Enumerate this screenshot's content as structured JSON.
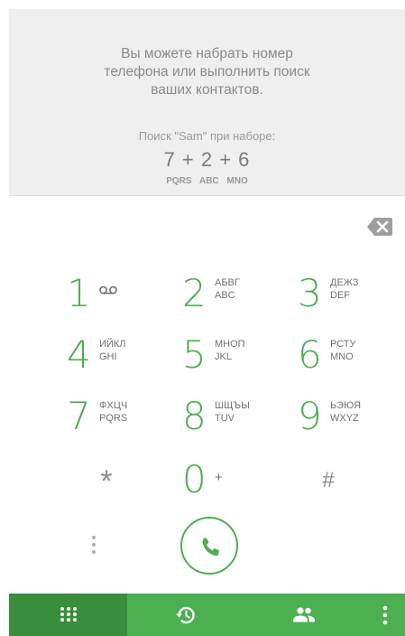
{
  "hint": {
    "line1": "Вы можете набрать номер",
    "line2": "телефона или выполнить поиск",
    "line3": "ваших контактов.",
    "search_caption": "Поиск \"Sam\" при наборе:",
    "search_digits": "7 + 2 + 6",
    "search_letters": "PQRS ABC MNO"
  },
  "keypad": {
    "keys": [
      {
        "digit": "1",
        "line1": "",
        "line2": ""
      },
      {
        "digit": "2",
        "line1": "АБВГ",
        "line2": "ABC"
      },
      {
        "digit": "3",
        "line1": "ДЕЖЗ",
        "line2": "DEF"
      },
      {
        "digit": "4",
        "line1": "ИЙКЛ",
        "line2": "GHI"
      },
      {
        "digit": "5",
        "line1": "МНОП",
        "line2": "JKL"
      },
      {
        "digit": "6",
        "line1": "РСТУ",
        "line2": "MNO"
      },
      {
        "digit": "7",
        "line1": "ФХЦЧ",
        "line2": "PQRS"
      },
      {
        "digit": "8",
        "line1": "ШЩЪЫ",
        "line2": "TUV"
      },
      {
        "digit": "9",
        "line1": "ЬЭЮЯ",
        "line2": "WXYZ"
      }
    ],
    "star": "*",
    "zero": "0",
    "plus": "+",
    "hash": "#"
  },
  "icons": {
    "voicemail": "voicemail-icon",
    "backspace": "backspace-icon",
    "call": "phone-icon",
    "overflow": "more-vert-icon",
    "tab_dialpad": "dialpad-icon",
    "tab_history": "history-icon",
    "tab_contacts": "contacts-icon",
    "tab_menu": "more-vert-icon"
  },
  "colors": {
    "accent": "#4caf50",
    "accent_dark": "#388e3c",
    "hint_background": "#efefef"
  }
}
